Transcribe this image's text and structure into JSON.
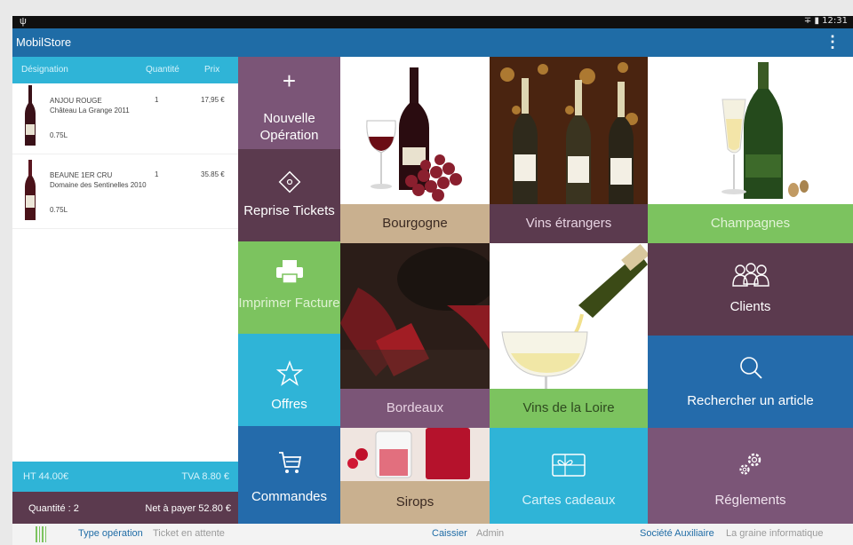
{
  "status": {
    "time": "12:31",
    "usb_icon": "usb-icon",
    "signal_icon": "signal-icon",
    "battery_icon": "battery-icon"
  },
  "app": {
    "title": "MobilStore",
    "menu_icon": "overflow-menu-icon"
  },
  "table": {
    "headers": [
      "Désignation",
      "Quantité",
      "Prix"
    ],
    "items": [
      {
        "name": "ANJOU ROUGE",
        "producer": "Château La Grange 2011",
        "volume": "0.75L",
        "quantity": "1",
        "price": "17,95 €"
      },
      {
        "name": "BEAUNE 1ER CRU",
        "producer": "Domaine des Sentinelles 2010",
        "volume": "0.75L",
        "quantity": "1",
        "price": "35.85 €"
      }
    ]
  },
  "totals": {
    "ht": "HT 44.00€",
    "tva": "TVA 8.80 €",
    "quantity": "Quantité : 2",
    "net": "Net à payer 52.80 €"
  },
  "tiles": {
    "nouvelle_operation": "Nouvelle Opération",
    "reprise_tickets": "Reprise Tickets",
    "imprimer_facture": "Imprimer Facture",
    "offres": "Offres",
    "commandes": "Commandes",
    "bourgogne": "Bourgogne",
    "vins_etrangers": "Vins étrangers",
    "champagnes": "Champagnes",
    "bordeaux": "Bordeaux",
    "vins_loire": "Vins de la Loire",
    "clients": "Clients",
    "rechercher": "Rechercher un article",
    "sirops": "Sirops",
    "cartes_cadeaux": "Cartes cadeaux",
    "reglements": "Réglements"
  },
  "footer": {
    "type_label": "Type opération",
    "type_value": "Ticket en attente",
    "caissier_label": "Caissier",
    "caissier_value": "Admin",
    "societe_label": "Société Auxiliaire",
    "societe_value": "La graine informatique"
  },
  "colors": {
    "appbar": "#1f6ca6",
    "cyan": "#2fb4d7",
    "plum": "#5b3a4e",
    "mauve": "#7b5577",
    "green": "#7cc35f",
    "tan": "#c9b08f",
    "blue": "#246bab"
  }
}
